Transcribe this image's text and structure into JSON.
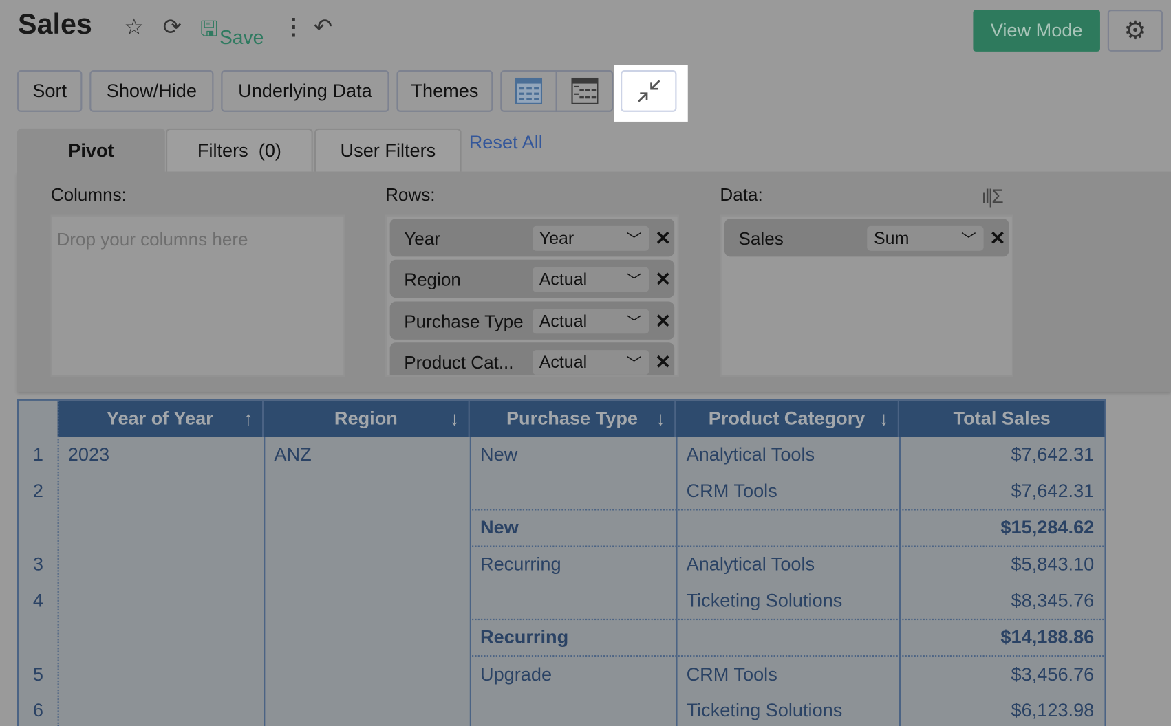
{
  "header": {
    "title": "Sales",
    "save_label": "Save",
    "view_mode": "View Mode"
  },
  "toolbar": {
    "sort": "Sort",
    "show_hide": "Show/Hide",
    "underlying": "Underlying Data",
    "themes": "Themes"
  },
  "tabs": {
    "pivot": "Pivot",
    "filters": "Filters  (0)",
    "user_filters": "User Filters",
    "reset_all": "Reset All"
  },
  "pivot": {
    "columns_label": "Columns:",
    "columns_placeholder": "Drop your columns here",
    "rows_label": "Rows:",
    "rows": [
      {
        "name": "Year",
        "option": "Year"
      },
      {
        "name": "Region",
        "option": "Actual"
      },
      {
        "name": "Purchase Type",
        "option": "Actual"
      },
      {
        "name": "Product Cat...",
        "option": "Actual"
      }
    ],
    "data_label": "Data:",
    "data": [
      {
        "name": "Sales",
        "option": "Sum"
      }
    ]
  },
  "table": {
    "headers": [
      "Year of Year",
      "Region",
      "Purchase Type",
      "Product Category",
      "Total Sales"
    ],
    "header_arrows": [
      "↑",
      "↓",
      "↓",
      "↓",
      ""
    ],
    "year": "2023",
    "region": "ANZ",
    "rows": [
      {
        "n": "1",
        "type": "New",
        "cat": "Analytical Tools",
        "sales": "$7,642.31"
      },
      {
        "n": "2",
        "type": "",
        "cat": "CRM Tools",
        "sales": "$7,642.31"
      },
      {
        "n": "",
        "type": "New",
        "cat": "",
        "sales": "$15,284.62",
        "subtotal": true
      },
      {
        "n": "3",
        "type": "Recurring",
        "cat": "Analytical Tools",
        "sales": "$5,843.10"
      },
      {
        "n": "4",
        "type": "",
        "cat": "Ticketing Solutions",
        "sales": "$8,345.76"
      },
      {
        "n": "",
        "type": "Recurring",
        "cat": "",
        "sales": "$14,188.86",
        "subtotal": true
      },
      {
        "n": "5",
        "type": "Upgrade",
        "cat": "CRM Tools",
        "sales": "$3,456.76"
      },
      {
        "n": "6",
        "type": "",
        "cat": "Ticketing Solutions",
        "sales": "$6,123.98"
      }
    ]
  }
}
